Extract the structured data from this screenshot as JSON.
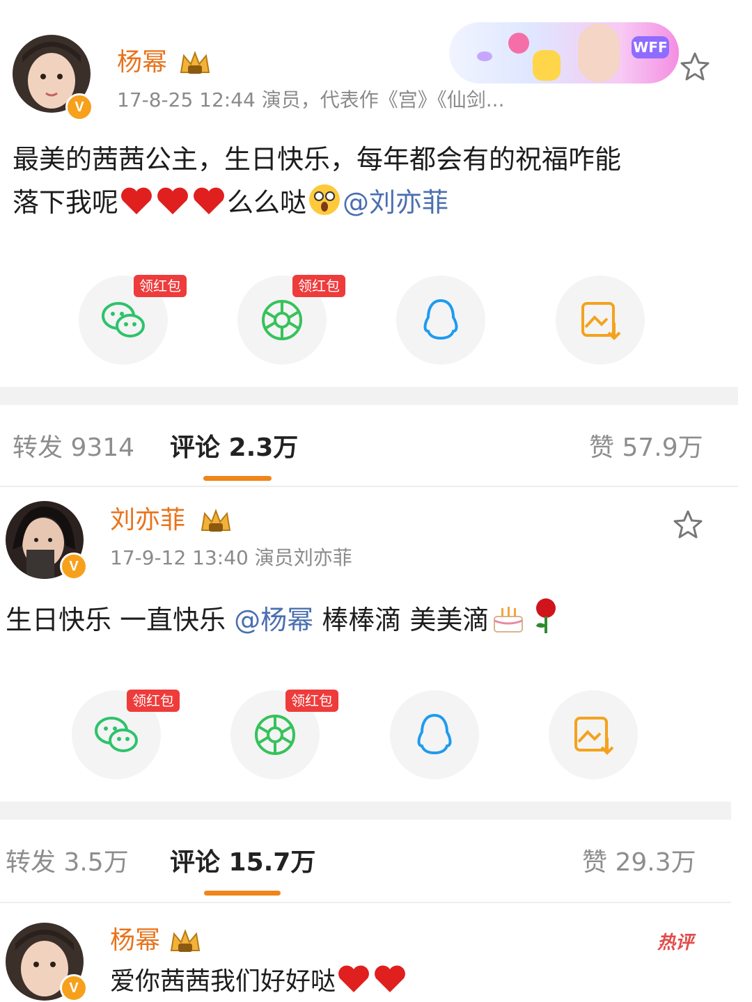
{
  "posts": [
    {
      "user": "杨幂",
      "meta": "17-8-25 12:44  演员，代表作《宫》《仙剑...",
      "text_line1": "最美的茜茜公主，生日快乐，每年都会有的祝福咋能",
      "text_line2_before": "落下我呢",
      "text_line2_after": "么么哒",
      "mention": "@刘亦菲",
      "share_tags": [
        "领红包",
        "领红包"
      ],
      "stats": {
        "repost": "转发 9314",
        "comment": "评论 2.3万",
        "like": "赞 57.9万"
      }
    },
    {
      "user": "刘亦菲",
      "meta": "17-9-12 13:40  演员刘亦菲",
      "text_before": "生日快乐 一直快乐 ",
      "mention": "@杨幂",
      "text_after": " 棒棒滴 美美滴",
      "share_tags": [
        "领红包",
        "领红包"
      ],
      "stats": {
        "repost": "转发 3.5万",
        "comment": "评论 15.7万",
        "like": "赞 29.3万"
      }
    }
  ],
  "comment": {
    "user": "杨幂",
    "text": "爱你茜茜我们好好哒",
    "hot_label": "热评"
  },
  "banner": {
    "label": "WFF"
  },
  "badge": "V",
  "colors": {
    "username": "#e8731b",
    "mention": "#4a6fb0",
    "accent": "#f08519",
    "red_tag": "#ee3b3b"
  }
}
